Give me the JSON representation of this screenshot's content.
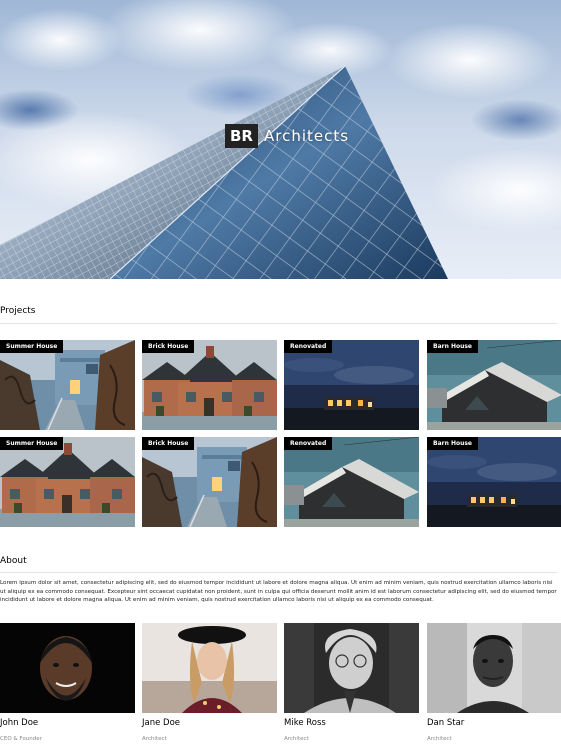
{
  "hero": {
    "brand_mark": "BR",
    "brand_name": "Architects"
  },
  "projects": {
    "title": "Projects",
    "tiles": [
      {
        "label": "Summer House",
        "scene": "summer-house"
      },
      {
        "label": "Brick House",
        "scene": "brick-house"
      },
      {
        "label": "Renovated",
        "scene": "renovated"
      },
      {
        "label": "Barn House",
        "scene": "barn-house"
      },
      {
        "label": "Summer House",
        "scene": "brick-house"
      },
      {
        "label": "Brick House",
        "scene": "summer-house"
      },
      {
        "label": "Renovated",
        "scene": "barn-house"
      },
      {
        "label": "Barn House",
        "scene": "renovated"
      }
    ]
  },
  "about": {
    "title": "About",
    "text": "Lorem ipsum dolor sit amet, consectetur adipiscing elit, sed do eiusmod tempor incididunt ut labore et dolore magna aliqua. Ut enim ad minim veniam, quis nostrud exercitation ullamco laboris nisi ut aliquip ex ea commodo consequat. Excepteur sint occaecat cupidatat non proident, sunt in culpa qui officia deserunt mollit anim id est laborum consectetur adipiscing elit, sed do eiusmod tempor incididunt ut labore et dolore magna aliqua. Ut enim ad minim veniam, quis nostrud exercitation ullamco laboris nisi ut aliquip ex ea commodo consequat."
  },
  "team": [
    {
      "name": "John Doe",
      "role": "CEO & Founder"
    },
    {
      "name": "Jane Doe",
      "role": "Architect"
    },
    {
      "name": "Mike Ross",
      "role": "Architect"
    },
    {
      "name": "Dan Star",
      "role": "Architect"
    }
  ]
}
